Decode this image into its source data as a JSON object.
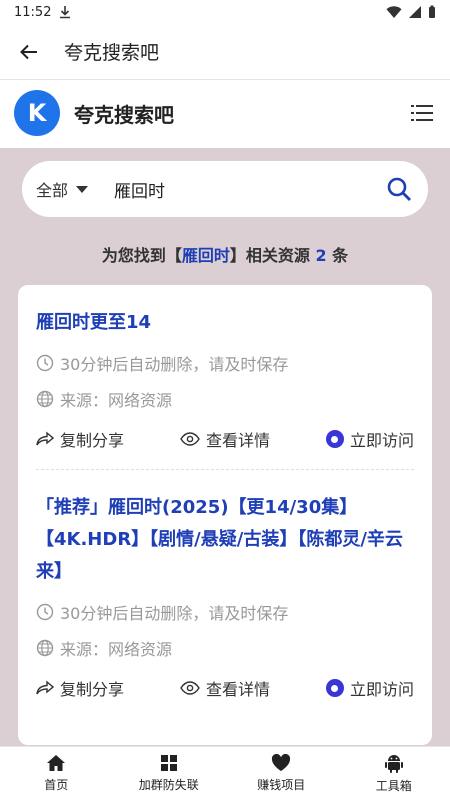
{
  "status": {
    "time": "11:52"
  },
  "appbar": {
    "title": "夸克搜索吧"
  },
  "site": {
    "logo_letter": "K",
    "name": "夸克搜索吧"
  },
  "search": {
    "scope": "全部",
    "query": "雁回时"
  },
  "result": {
    "prefix": "为您找到【",
    "keyword": "雁回时",
    "middle": "】相关资源 ",
    "count": "2",
    "suffix": " 条"
  },
  "items": [
    {
      "title": "雁回时更至14",
      "expire": "30分钟后自动删除，请及时保存",
      "source": "来源：网络资源",
      "copy": "复制分享",
      "detail": "查看详情",
      "visit": "立即访问"
    },
    {
      "title": "「推荐」雁回时(2025)【更14/30集】【4K.HDR】【剧情/悬疑/古装】【陈都灵/辛云来】",
      "expire": "30分钟后自动删除，请及时保存",
      "source": "来源：网络资源",
      "copy": "复制分享",
      "detail": "查看详情",
      "visit": "立即访问"
    }
  ],
  "nav": [
    {
      "label": "首页"
    },
    {
      "label": "加群防失联"
    },
    {
      "label": "赚钱项目"
    },
    {
      "label": "工具箱"
    }
  ]
}
